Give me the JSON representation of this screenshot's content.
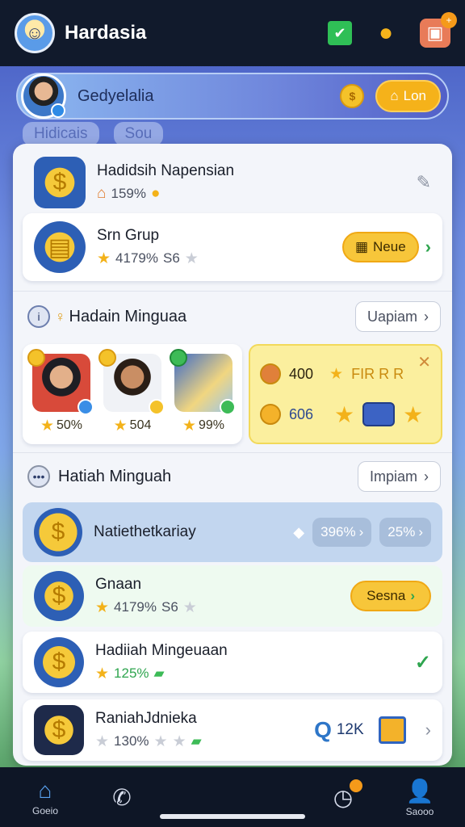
{
  "header": {
    "title": "Hardasia",
    "icons": [
      "green-check-icon",
      "coin-stack-icon",
      "gift-icon"
    ]
  },
  "profile": {
    "name": "Gedyelalia",
    "button_label": "Lon"
  },
  "background_chips": [
    "Hidicais",
    "Sou"
  ],
  "rows": {
    "top1": {
      "title": "Hadidsih Napensian",
      "sub": "159%"
    },
    "top2": {
      "title": "Srn Grup",
      "sub": "4179%",
      "sub2": "S6",
      "button": "Neue"
    }
  },
  "section1": {
    "title": "Hadain Minguaa",
    "button": "Uapiam",
    "cards": [
      {
        "value": "50%"
      },
      {
        "value": "504"
      },
      {
        "value": "99%"
      }
    ],
    "reward": {
      "line1": "400",
      "line1_text": "FIR R R",
      "line2": "606"
    }
  },
  "section2": {
    "title": "Hatiah Minguah",
    "button": "Impiam",
    "rows": [
      {
        "title": "Natiethetkariay",
        "chip1": "396%",
        "chip2": "25%"
      },
      {
        "title": "Gnaan",
        "sub": "4179%",
        "sub2": "S6",
        "button": "Sesna"
      },
      {
        "title": "Hadiiah Mingeuaan",
        "sub": "125%"
      },
      {
        "title": "RaniahJdnieka",
        "sub": "130%",
        "count": "12K"
      }
    ]
  },
  "bottom_nav": [
    {
      "label": "Goeio"
    },
    {
      "label": ""
    },
    {
      "label": ""
    },
    {
      "label": "Saooo"
    }
  ]
}
